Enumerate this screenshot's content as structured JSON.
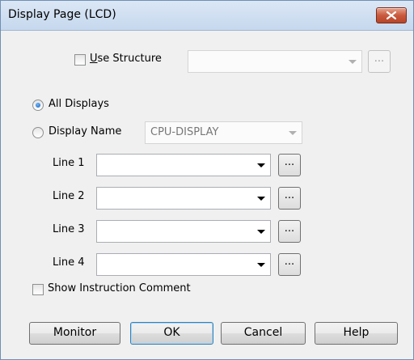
{
  "window": {
    "title": "Display Page (LCD)",
    "close_icon": "close-x-icon",
    "close_color": "#c85a3e"
  },
  "use_structure": {
    "label": "Use Structure",
    "checked": false,
    "value": "",
    "browse_label": "..."
  },
  "display_mode": {
    "all_displays_label": "All Displays",
    "display_name_label": "Display Name",
    "selected": "All Displays",
    "display_name_value": "CPU-DISPLAY"
  },
  "lines": [
    {
      "label": "Line 1",
      "value": "",
      "browse_label": "..."
    },
    {
      "label": "Line 2",
      "value": "",
      "browse_label": "..."
    },
    {
      "label": "Line 3",
      "value": "",
      "browse_label": "..."
    },
    {
      "label": "Line 4",
      "value": "",
      "browse_label": "..."
    }
  ],
  "show_instruction_comment": {
    "label": "Show Instruction Comment",
    "checked": false
  },
  "buttons": {
    "monitor": "Monitor",
    "ok": "OK",
    "cancel": "Cancel",
    "help": "Help"
  }
}
